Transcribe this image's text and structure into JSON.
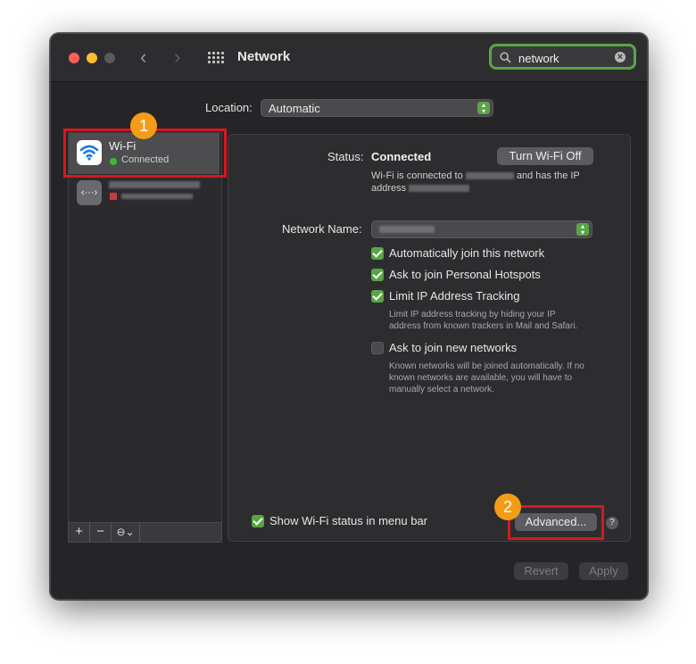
{
  "window": {
    "title": "Network"
  },
  "search": {
    "value": "network"
  },
  "location": {
    "label": "Location:",
    "value": "Automatic"
  },
  "sidebar": {
    "items": [
      {
        "name": "Wi-Fi",
        "status": "Connected",
        "status_color": "#3db83d"
      }
    ],
    "footer": {
      "add": "+",
      "remove": "−",
      "action": "⊖⌄"
    }
  },
  "callouts": {
    "one": "1",
    "two": "2"
  },
  "panel": {
    "status_label": "Status:",
    "status_value": "Connected",
    "turn_off_button": "Turn Wi-Fi Off",
    "status_desc_1": "Wi-Fi is connected to",
    "status_desc_2": "and has the IP",
    "status_desc_3": "address",
    "network_name_label": "Network Name:",
    "options": [
      {
        "label": "Automatically join this network",
        "checked": true
      },
      {
        "label": "Ask to join Personal Hotspots",
        "checked": true
      },
      {
        "label": "Limit IP Address Tracking",
        "checked": true
      },
      {
        "label": "Ask to join new networks",
        "checked": false
      }
    ],
    "limit_ip_help_1": "Limit IP address tracking by hiding your IP",
    "limit_ip_help_2": "address from known trackers in Mail and Safari.",
    "new_networks_help_1": "Known networks will be joined automatically. If no",
    "new_networks_help_2": "known networks are available, you will have to",
    "new_networks_help_3": "manually select a network.",
    "show_status_label": "Show Wi-Fi status in menu bar",
    "advanced_button": "Advanced...",
    "help_button": "?"
  },
  "footer": {
    "revert": "Revert",
    "apply": "Apply"
  },
  "colors": {
    "accent": "#59a546",
    "highlight": "#d8171f",
    "badge": "#f39c17"
  }
}
